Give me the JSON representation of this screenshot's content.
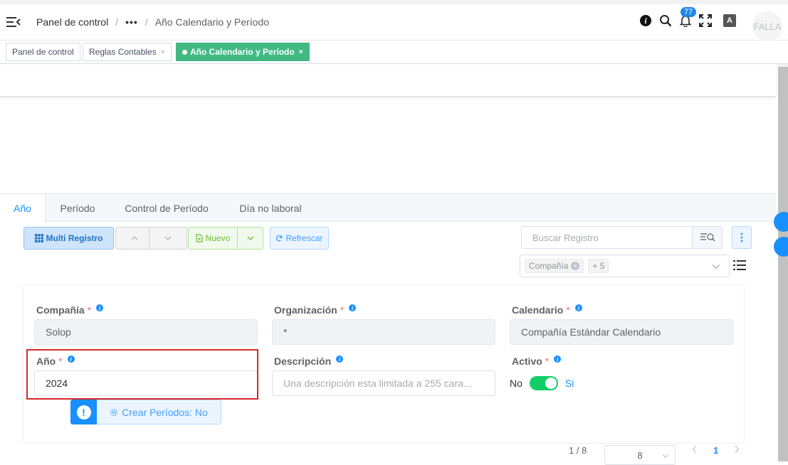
{
  "header": {
    "breadcrumb": {
      "home": "Panel de control",
      "separator": "/",
      "ellipsis": "•••",
      "current": "Año Calendario y Período"
    },
    "notification_count": "77",
    "language_icon_text": "A",
    "avatar_text": "FALLA"
  },
  "tags": [
    {
      "label": "Panel de control",
      "closable": false
    },
    {
      "label": "Reglas Contables",
      "close": "×"
    },
    {
      "label": "Año Calendario y Período",
      "close": "×",
      "active": true
    }
  ],
  "tabs": [
    {
      "label": "Año",
      "active": true
    },
    {
      "label": "Período"
    },
    {
      "label": "Control de Período"
    },
    {
      "label": "Día no laboral"
    }
  ],
  "toolbar": {
    "multi_record": "Multi Registro",
    "new": "Nuevo",
    "refresh": "Refrescar",
    "search_placeholder": "Buscar Registro",
    "filter_chip": "Compañía",
    "filter_more": "+ 5"
  },
  "form": {
    "company": {
      "label": "Compañía",
      "required": "*",
      "value": "Solop"
    },
    "organization": {
      "label": "Organización",
      "required": "*",
      "value": "*"
    },
    "calendar": {
      "label": "Calendario",
      "required": "*",
      "value": "Compañía Estándar Calendario"
    },
    "year": {
      "label": "Año",
      "required": "*",
      "value": "2024"
    },
    "description": {
      "label": "Descripción",
      "placeholder": "Una descripción esta limitada a 255 cara..."
    },
    "active": {
      "label": "Activo",
      "required": "*",
      "off_label": "No",
      "on_label": "Si",
      "value": true
    },
    "process_button": "Crear Períodos: No"
  },
  "pagination": {
    "record_position": "1 / 8",
    "page_size": "8",
    "current_page": "1"
  },
  "colors": {
    "primary": "#1890ff",
    "active_tag": "#42b983",
    "switch_on": "#13ce66",
    "highlight_border": "#d42a2a"
  }
}
